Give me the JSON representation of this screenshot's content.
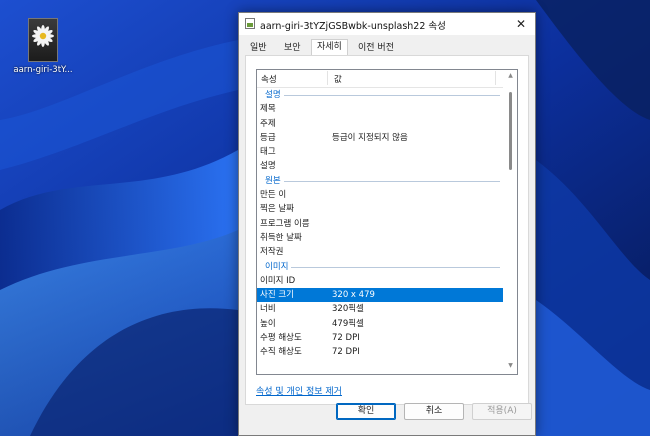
{
  "desktop": {
    "icon_label": "aarn-giri-3tY..."
  },
  "dialog": {
    "title": "aarn-giri-3tYZjGSBwbk-unsplash22 속성",
    "close_glyph": "✕",
    "tabs": [
      {
        "label": "일반"
      },
      {
        "label": "보안"
      },
      {
        "label": "자세히"
      },
      {
        "label": "이전 버전"
      }
    ],
    "list": {
      "col_property": "속성",
      "col_value": "값",
      "groups": {
        "description": {
          "title": "설명",
          "rows": [
            {
              "k": "제목",
              "v": ""
            },
            {
              "k": "주제",
              "v": ""
            },
            {
              "k": "등급",
              "v": "등급이 지정되지 않음"
            },
            {
              "k": "태그",
              "v": ""
            },
            {
              "k": "설명",
              "v": ""
            }
          ]
        },
        "origin": {
          "title": "원본",
          "rows": [
            {
              "k": "만든 이",
              "v": ""
            },
            {
              "k": "찍은 날짜",
              "v": ""
            },
            {
              "k": "프로그램 이름",
              "v": ""
            },
            {
              "k": "취득한 날짜",
              "v": ""
            },
            {
              "k": "저작권",
              "v": ""
            }
          ]
        },
        "image": {
          "title": "이미지",
          "rows": [
            {
              "k": "이미지 ID",
              "v": ""
            },
            {
              "k": "사진 크기",
              "v": "320 x 479"
            },
            {
              "k": "너비",
              "v": "320픽셀"
            },
            {
              "k": "높이",
              "v": "479픽셀"
            },
            {
              "k": "수평 해상도",
              "v": "72 DPI"
            },
            {
              "k": "수직 해상도",
              "v": "72 DPI"
            }
          ]
        }
      },
      "selected_row": "사진 크기"
    },
    "remove_link": "속성 및 개인 정보 제거",
    "buttons": {
      "ok": "확인",
      "cancel": "취소",
      "apply": "적용(A)"
    }
  },
  "colors": {
    "accent": "#0078d7",
    "link": "#0066cc",
    "wallpaper": "#0b2a8e"
  }
}
